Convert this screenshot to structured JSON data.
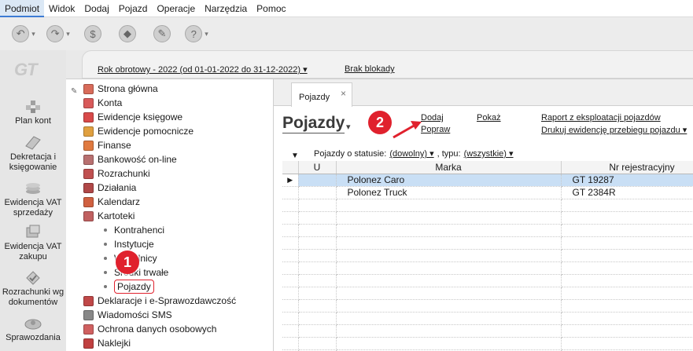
{
  "menu": [
    "Podmiot",
    "Widok",
    "Dodaj",
    "Pojazd",
    "Operacje",
    "Narzędzia",
    "Pomoc"
  ],
  "toolbar": {
    "buttons": [
      {
        "icon": "back-icon",
        "glyph": "↶"
      },
      {
        "icon": "forward-icon",
        "glyph": "↷"
      },
      {
        "icon": "coins-icon",
        "glyph": "$"
      },
      {
        "icon": "eraser-icon",
        "glyph": "◆"
      },
      {
        "icon": "tools-icon",
        "glyph": "✎"
      },
      {
        "icon": "help-icon",
        "glyph": "?"
      }
    ]
  },
  "sidebar": {
    "logo": "GT",
    "items": [
      "Plan kont",
      "Dekretacja i księgowanie",
      "Ewidencja VAT sprzedaży",
      "Ewidencja VAT zakupu",
      "Rozrachunki wg dokumentów",
      "Sprawozdania"
    ]
  },
  "header": {
    "rok": "Rok obrotowy - 2022  (od 01-01-2022 do 31-12-2022) ▾",
    "blokada": "Brak blokady"
  },
  "tree": {
    "items": [
      {
        "label": "Strona główna",
        "color": "#d86b5a"
      },
      {
        "label": "Konta",
        "color": "#d85a5a"
      },
      {
        "label": "Ewidencje księgowe",
        "color": "#d84a4a"
      },
      {
        "label": "Ewidencje pomocnicze",
        "color": "#e0a040"
      },
      {
        "label": "Finanse",
        "color": "#e07a40"
      },
      {
        "label": "Bankowość on-line",
        "color": "#b87070"
      },
      {
        "label": "Rozrachunki",
        "color": "#c05050"
      },
      {
        "label": "Działania",
        "color": "#b04848"
      },
      {
        "label": "Kalendarz",
        "color": "#d06040"
      },
      {
        "label": "Kartoteki",
        "color": "#c06060"
      }
    ],
    "subitems": [
      "Kontrahenci",
      "Instytucje",
      "Wspólnicy",
      "Środki trwałe",
      "Pojazdy"
    ],
    "items_after": [
      {
        "label": "Deklaracje i e-Sprawozdawczość",
        "color": "#c04848"
      },
      {
        "label": "Wiadomości SMS",
        "color": "#888888"
      },
      {
        "label": "Ochrona danych osobowych",
        "color": "#d06060"
      },
      {
        "label": "Naklejki",
        "color": "#c04040"
      }
    ]
  },
  "main": {
    "tab_label": "Pojazdy",
    "tab_close": "×",
    "title": "Pojazdy",
    "actions": {
      "dodaj": "Dodaj",
      "popraw": "Popraw",
      "pokaz": "Pokaż",
      "raport": "Raport z eksploatacji pojazdów",
      "drukuj": "Drukuj ewidencję przebiegu pojazdu ▾"
    },
    "filter": {
      "label": "Pojazdy o statusie:",
      "status": "(dowolny) ▾",
      "typ_label": ", typu:",
      "typ": "(wszystkie) ▾"
    },
    "columns": [
      "",
      "U",
      "Marka",
      "Nr rejestracyjny"
    ],
    "rows": [
      {
        "marka": "Polonez Caro",
        "nr": "GT 19287"
      },
      {
        "marka": "Polonez Truck",
        "nr": "GT 2384R"
      }
    ]
  },
  "annotations": {
    "badge1": "1",
    "badge2": "2",
    "color": "#e0212d"
  }
}
